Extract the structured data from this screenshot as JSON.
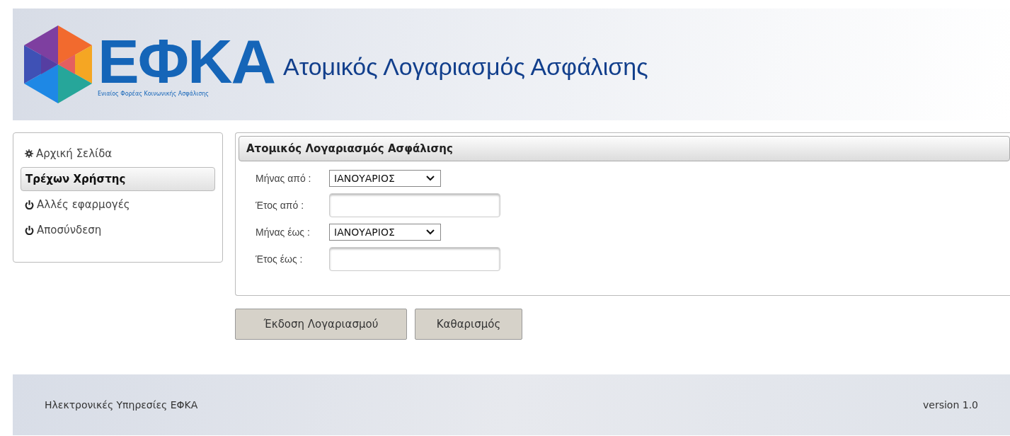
{
  "header": {
    "logo_text": "ΕΦΚΑ",
    "logo_subtitle": "Ενιαίος Φορέας Κοινωνικής Ασφάλισης",
    "title": "Ατομικός Λογαριασμός Ασφάλισης"
  },
  "sidebar": {
    "items": [
      {
        "label": "Αρχική Σελίδα",
        "kind": "gear",
        "selected": false
      },
      {
        "label": "Τρέχων Χρήστης",
        "kind": "plain",
        "selected": true
      },
      {
        "label": "Αλλές εφαρμογές",
        "kind": "power",
        "selected": false
      },
      {
        "label": "Αποσύνδεση",
        "kind": "power",
        "selected": false
      }
    ]
  },
  "panel": {
    "title": "Ατομικός Λογαριασμός Ασφάλισης",
    "fields": [
      {
        "label": "Μήνας από :",
        "kind": "select",
        "value": "ΙΑΝΟΥΑΡΙΟΣ"
      },
      {
        "label": "Έτος από :",
        "kind": "text"
      },
      {
        "label": "Μήνας έως :",
        "kind": "select",
        "value": "ΙΑΝΟΥΑΡΙΟΣ"
      },
      {
        "label": "Έτος έως :",
        "kind": "text"
      }
    ]
  },
  "buttons": [
    "Έκδοση Λογαριασμού",
    "Καθαρισμός"
  ],
  "footer": {
    "left": "Ηλεκτρονικές Υπηρεσίες ΕΦΚΑ",
    "right": "version 1.0"
  }
}
